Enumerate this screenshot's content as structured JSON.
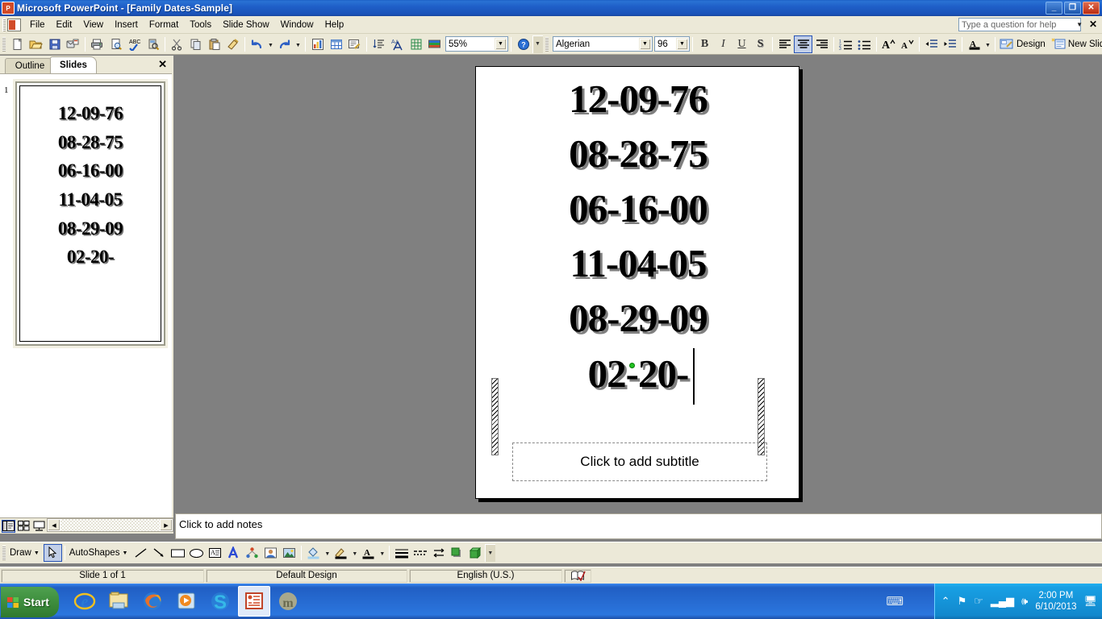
{
  "window": {
    "app_icon": "powerpoint-icon",
    "title": "Microsoft PowerPoint - [Family Dates-Sample]",
    "minimize": "_",
    "restore": "❐",
    "close": "✕"
  },
  "menubar": {
    "items": [
      {
        "label": "File",
        "accel": "F"
      },
      {
        "label": "Edit",
        "accel": "E"
      },
      {
        "label": "View",
        "accel": "V"
      },
      {
        "label": "Insert",
        "accel": "I"
      },
      {
        "label": "Format",
        "accel": "o"
      },
      {
        "label": "Tools",
        "accel": "T"
      },
      {
        "label": "Slide Show",
        "accel": "S"
      },
      {
        "label": "Window",
        "accel": "W"
      },
      {
        "label": "Help",
        "accel": "H"
      }
    ],
    "help_placeholder": "Type a question for help",
    "close_label": "✕"
  },
  "standard_toolbar": {
    "buttons": [
      "new-icon",
      "open-icon",
      "save-icon",
      "email-icon",
      "print-icon",
      "print-preview-icon",
      "spelling-icon",
      "research-icon",
      "cut-icon",
      "copy-icon",
      "paste-icon",
      "format-painter-icon",
      "undo-icon",
      "redo-icon",
      "insert-chart-icon",
      "insert-table-icon",
      "insert-hyperlink-icon",
      "sort-icon",
      "expand-all-icon",
      "show-grid-icon",
      "color-scheme-icon"
    ],
    "zoom_value": "55%",
    "help_icon": "help-icon"
  },
  "formatting_toolbar": {
    "font_name": "Algerian",
    "font_size": "96",
    "bold": "B",
    "italic": "I",
    "underline": "U",
    "shadow": "S",
    "align_left": "align-left-icon",
    "align_center": "align-center-icon",
    "align_right": "align-right-icon",
    "numbering": "numbering-icon",
    "bullets": "bullets-icon",
    "increase_font": "A",
    "decrease_font": "A",
    "decrease_indent": "decrease-indent-icon",
    "increase_indent": "increase-indent-icon",
    "font_color": "A",
    "design_label": "Design",
    "design_accel": "D",
    "new_slide_label": "New Slide",
    "new_slide_accel": "N"
  },
  "left_pane": {
    "tabs": [
      {
        "label": "Outline",
        "active": false
      },
      {
        "label": "Slides",
        "active": true
      }
    ],
    "close_label": "✕",
    "slide_number": "1",
    "thumbnail_lines": [
      "12-09-76",
      "08-28-75",
      "06-16-00",
      "11-04-05",
      "08-29-09",
      "02-20-"
    ]
  },
  "view_buttons": [
    {
      "name": "normal-view-button",
      "active": true
    },
    {
      "name": "slide-sorter-view-button",
      "active": false
    },
    {
      "name": "slide-show-view-button",
      "active": false
    }
  ],
  "slide": {
    "title_lines": [
      "12-09-76",
      "08-28-75",
      "06-16-00",
      "11-04-05",
      "08-29-09",
      "02-20-"
    ],
    "subtitle_placeholder": "Click to add subtitle"
  },
  "notes": {
    "placeholder": "Click to add notes"
  },
  "drawing_toolbar": {
    "draw_label": "Draw",
    "draw_accel": "r",
    "select_icon": "select-objects-icon",
    "autoshapes_label": "AutoShapes",
    "autoshapes_accel": "u",
    "tools": [
      "line-icon",
      "arrow-icon",
      "rectangle-icon",
      "oval-icon",
      "text-box-icon",
      "wordart-icon",
      "diagram-icon",
      "clip-art-icon",
      "picture-icon",
      "fill-color-icon",
      "line-color-icon",
      "font-color-icon",
      "line-style-icon",
      "dash-style-icon",
      "arrow-style-icon",
      "shadow-style-icon",
      "3d-style-icon"
    ]
  },
  "statusbar": {
    "slide_info": "Slide 1 of 1",
    "design": "Default Design",
    "language": "English (U.S.)",
    "spellcheck_icon": "spelling-status-icon"
  },
  "taskbar": {
    "start_label": "Start",
    "apps": [
      {
        "name": "internet-explorer-icon",
        "active": false
      },
      {
        "name": "windows-explorer-icon",
        "active": false
      },
      {
        "name": "firefox-icon",
        "active": false
      },
      {
        "name": "media-player-icon",
        "active": false
      },
      {
        "name": "skype-icon",
        "active": false
      },
      {
        "name": "powerpoint-taskbar-icon",
        "active": true
      },
      {
        "name": "mozy-icon",
        "active": false
      }
    ],
    "tray_icons": [
      "bluetooth-icon",
      "flag-icon",
      "safely-remove-icon",
      "network-icon",
      "volume-icon"
    ],
    "time": "2:00 PM",
    "date": "6/10/2013"
  },
  "colors": {
    "titlebar_blue": "#1f5fc8",
    "chrome": "#ece9d8",
    "workspace_gray": "#808080",
    "selection_blue": "#c2cfe8",
    "rotate_handle_green": "#22c322"
  }
}
